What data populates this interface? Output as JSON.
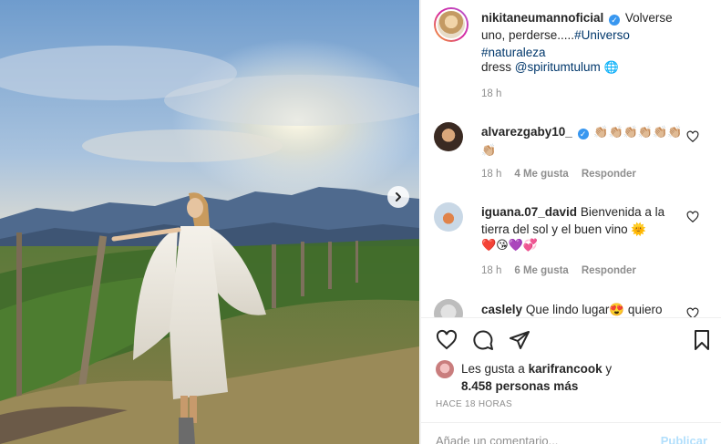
{
  "post": {
    "next_icon": "chevron-right-icon"
  },
  "caption": {
    "username": "nikitaneumannoficial",
    "verified_icon": "verified-badge-icon",
    "text": "Volverse uno, perderse.....",
    "hashtags": "#Universo #naturaleza",
    "dress_label": "dress",
    "dress_tag": "@spiritumtulum",
    "dress_emoji": "🌐",
    "time": "18 h"
  },
  "comments": [
    {
      "username": "alvarezgaby10_",
      "verified": true,
      "text": "👏🏼👏🏼👏🏼👏🏼👏🏼👏🏼👏🏼",
      "time": "18 h",
      "likes": "4 Me gusta",
      "reply": "Responder"
    },
    {
      "username": "iguana.07_david",
      "verified": false,
      "text": "Bienvenida a la tierra del sol y el buen vino 🌞",
      "emojis": "❤️😘💜💞",
      "time": "18 h",
      "likes": "6 Me gusta",
      "reply": "Responder"
    },
    {
      "username": "caslely",
      "verified": false,
      "text": "Que lindo lugar😍 quiero"
    }
  ],
  "actions": {
    "like_icon": "heart-icon",
    "comment_icon": "comment-icon",
    "share_icon": "paper-plane-icon",
    "save_icon": "bookmark-icon"
  },
  "likes": {
    "prefix": "Les gusta a",
    "user": "karifrancook",
    "conj": "y",
    "others": "8.458 personas más"
  },
  "posted_ago": "HACE 18 HORAS",
  "comment_box": {
    "placeholder": "Añade un comentario...",
    "publish": "Publicar"
  },
  "colors": {
    "accent": "#3897f0",
    "link": "#00376b",
    "muted": "#8e8e8e",
    "text": "#262626"
  }
}
